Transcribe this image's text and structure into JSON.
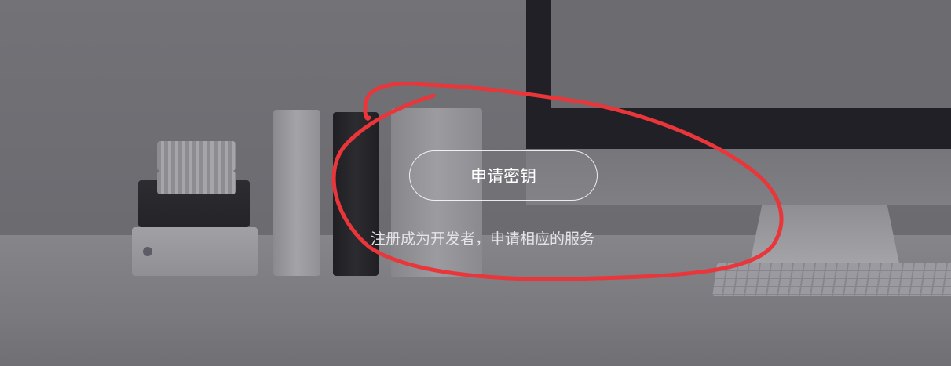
{
  "hero": {
    "apply_button_label": "申请密钥",
    "subtitle": "注册成为开发者，申请相应的服务"
  },
  "colors": {
    "annotation": "#e8363a",
    "overlay_text": "#ffffff"
  }
}
